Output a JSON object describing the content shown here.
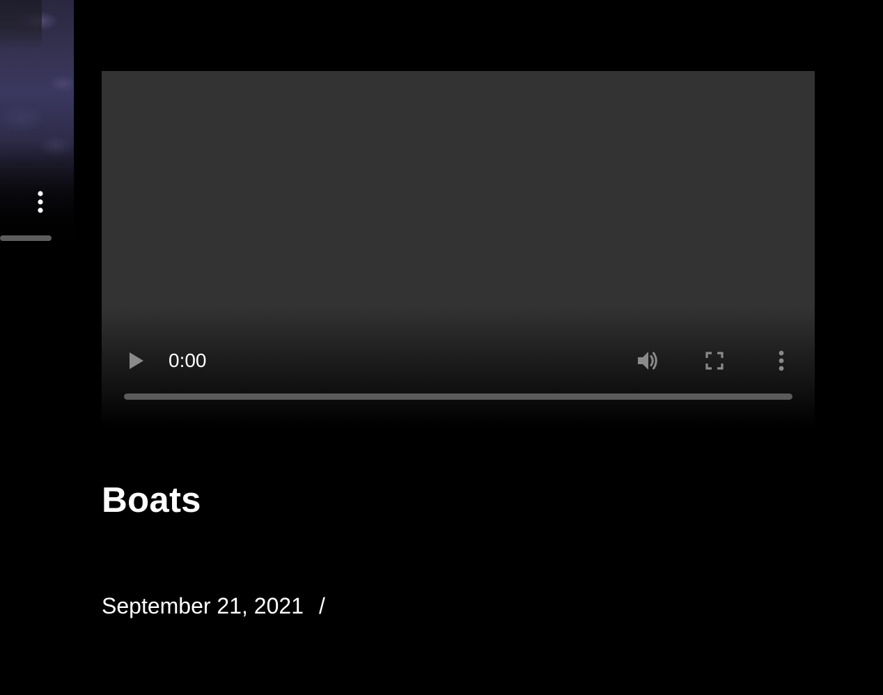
{
  "previous_video": {
    "more_options_icon": "three-dots-vertical-icon",
    "progress_fraction": 0
  },
  "player": {
    "background_color": "#333333",
    "time": "0:00",
    "progress_fraction": 0,
    "icons": {
      "play": "play-icon",
      "volume": "volume-icon",
      "fullscreen": "fullscreen-icon",
      "more": "three-dots-vertical-icon"
    }
  },
  "post": {
    "title": "Boats",
    "date": "September 21, 2021",
    "separator": "/"
  }
}
